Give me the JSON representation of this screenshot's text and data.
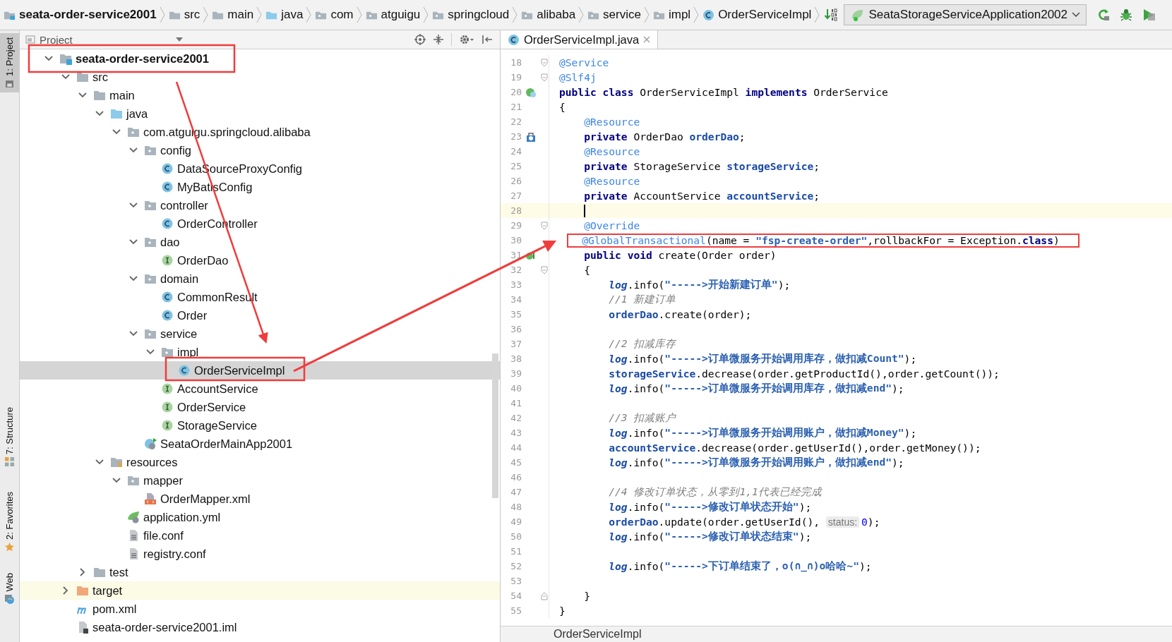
{
  "breadcrumbs": [
    {
      "label": "seata-order-service2001",
      "kind": "module"
    },
    {
      "label": "src",
      "kind": "folder"
    },
    {
      "label": "main",
      "kind": "folder"
    },
    {
      "label": "java",
      "kind": "source"
    },
    {
      "label": "com",
      "kind": "package"
    },
    {
      "label": "atguigu",
      "kind": "package"
    },
    {
      "label": "springcloud",
      "kind": "package"
    },
    {
      "label": "alibaba",
      "kind": "package"
    },
    {
      "label": "service",
      "kind": "package"
    },
    {
      "label": "impl",
      "kind": "package"
    },
    {
      "label": "OrderServiceImpl",
      "kind": "class"
    }
  ],
  "run_config": {
    "label": "SeataStorageServiceApplication2002"
  },
  "tool_windows": [
    {
      "label": "1: Project",
      "selected": true,
      "kind": "project"
    },
    {
      "label": "7: Structure",
      "selected": false,
      "kind": "structure"
    },
    {
      "label": "2: Favorites",
      "selected": false,
      "kind": "favorites"
    },
    {
      "label": "Web",
      "selected": false,
      "kind": "web"
    }
  ],
  "project": {
    "title": "Project",
    "tree": [
      {
        "label": "seata-order-service2001",
        "kind": "module",
        "expanded": true,
        "selected": false,
        "children": [
          {
            "label": "src",
            "kind": "folder",
            "expanded": true,
            "selected": false,
            "children": [
              {
                "label": "main",
                "kind": "folder",
                "expanded": true,
                "selected": false,
                "children": [
                  {
                    "label": "java",
                    "kind": "source",
                    "expanded": true,
                    "selected": false,
                    "children": [
                      {
                        "label": "com.atguigu.springcloud.alibaba",
                        "kind": "package",
                        "expanded": true,
                        "selected": false,
                        "children": [
                          {
                            "label": "config",
                            "kind": "package",
                            "expanded": true,
                            "selected": false,
                            "children": [
                              {
                                "label": "DataSourceProxyConfig",
                                "kind": "class",
                                "selected": false
                              },
                              {
                                "label": "MyBatisConfig",
                                "kind": "class",
                                "selected": false
                              }
                            ]
                          },
                          {
                            "label": "controller",
                            "kind": "package",
                            "expanded": true,
                            "selected": false,
                            "children": [
                              {
                                "label": "OrderController",
                                "kind": "class",
                                "selected": false
                              }
                            ]
                          },
                          {
                            "label": "dao",
                            "kind": "package",
                            "expanded": true,
                            "selected": false,
                            "children": [
                              {
                                "label": "OrderDao",
                                "kind": "interface",
                                "selected": false
                              }
                            ]
                          },
                          {
                            "label": "domain",
                            "kind": "package",
                            "expanded": true,
                            "selected": false,
                            "children": [
                              {
                                "label": "CommonResult",
                                "kind": "class",
                                "selected": false
                              },
                              {
                                "label": "Order",
                                "kind": "class",
                                "selected": false
                              }
                            ]
                          },
                          {
                            "label": "service",
                            "kind": "package",
                            "expanded": true,
                            "selected": false,
                            "children": [
                              {
                                "label": "impl",
                                "kind": "package",
                                "expanded": true,
                                "selected": false,
                                "children": [
                                  {
                                    "label": "OrderServiceImpl",
                                    "kind": "class",
                                    "selected": true
                                  }
                                ]
                              },
                              {
                                "label": "AccountService",
                                "kind": "interface",
                                "selected": false
                              },
                              {
                                "label": "OrderService",
                                "kind": "interface",
                                "selected": false
                              },
                              {
                                "label": "StorageService",
                                "kind": "interface",
                                "selected": false
                              }
                            ]
                          },
                          {
                            "label": "SeataOrderMainApp2001",
                            "kind": "boot",
                            "selected": false
                          }
                        ]
                      }
                    ]
                  },
                  {
                    "label": "resources",
                    "kind": "resources",
                    "expanded": true,
                    "selected": false,
                    "children": [
                      {
                        "label": "mapper",
                        "kind": "package",
                        "expanded": true,
                        "selected": false,
                        "children": [
                          {
                            "label": "OrderMapper.xml",
                            "kind": "xml",
                            "selected": false
                          }
                        ]
                      },
                      {
                        "label": "application.yml",
                        "kind": "yml",
                        "selected": false
                      },
                      {
                        "label": "file.conf",
                        "kind": "file",
                        "selected": false
                      },
                      {
                        "label": "registry.conf",
                        "kind": "file",
                        "selected": false
                      }
                    ]
                  }
                ]
              },
              {
                "label": "test",
                "kind": "folder",
                "expanded": false,
                "selected": false
              }
            ]
          },
          {
            "label": "target",
            "kind": "excluded",
            "expanded": false,
            "selected": false
          },
          {
            "label": "pom.xml",
            "kind": "maven",
            "selected": false
          },
          {
            "label": "seata-order-service2001.iml",
            "kind": "iml",
            "selected": false
          }
        ]
      }
    ]
  },
  "editor": {
    "tab": {
      "label": "OrderServiceImpl.java",
      "selected": true
    },
    "lines": [
      {
        "number": "18",
        "kind": "fold-start",
        "tokens": [
          {
            "kind": "ann",
            "text": "@Service"
          }
        ]
      },
      {
        "number": "19",
        "kind": "fold-start",
        "tokens": [
          {
            "kind": "ann",
            "text": "@Slf4j"
          }
        ]
      },
      {
        "number": "20",
        "kind": "bean",
        "tokens": [
          {
            "kind": "kw",
            "text": "public class "
          },
          {
            "kind": "plain",
            "text": "OrderServiceImpl "
          },
          {
            "kind": "kw",
            "text": "implements "
          },
          {
            "kind": "plain",
            "text": "OrderService"
          }
        ]
      },
      {
        "number": "21",
        "kind": "code",
        "tokens": [
          {
            "kind": "plain",
            "text": "{"
          }
        ],
        "children": [
          {
            "number": "22",
            "kind": "code",
            "tokens": [
              {
                "kind": "ann",
                "text": "@Resource"
              }
            ]
          },
          {
            "number": "23",
            "kind": "inject",
            "tokens": [
              {
                "kind": "kw",
                "text": "private "
              },
              {
                "kind": "plain",
                "text": "OrderDao "
              },
              {
                "kind": "field",
                "text": "orderDao"
              },
              {
                "kind": "plain",
                "text": ";"
              }
            ]
          },
          {
            "number": "24",
            "kind": "code",
            "tokens": [
              {
                "kind": "ann",
                "text": "@Resource"
              }
            ]
          },
          {
            "number": "25",
            "kind": "code",
            "tokens": [
              {
                "kind": "kw",
                "text": "private "
              },
              {
                "kind": "plain",
                "text": "StorageService "
              },
              {
                "kind": "field",
                "text": "storageService"
              },
              {
                "kind": "plain",
                "text": ";"
              }
            ]
          },
          {
            "number": "26",
            "kind": "code",
            "tokens": [
              {
                "kind": "ann",
                "text": "@Resource"
              }
            ]
          },
          {
            "number": "27",
            "kind": "code",
            "tokens": [
              {
                "kind": "kw",
                "text": "private "
              },
              {
                "kind": "plain",
                "text": "AccountService "
              },
              {
                "kind": "field",
                "text": "accountService"
              },
              {
                "kind": "plain",
                "text": ";"
              }
            ]
          },
          {
            "number": "28",
            "kind": "code",
            "current": true
          },
          {
            "number": "29",
            "kind": "fold-start",
            "tokens": [
              {
                "kind": "ann",
                "text": "@Override"
              }
            ]
          },
          {
            "number": "30",
            "kind": "code",
            "highlighted": true,
            "tokens": [
              {
                "kind": "ann",
                "text": "@GlobalTransactional"
              },
              {
                "kind": "plain",
                "text": "(name = "
              },
              {
                "kind": "str",
                "text": "\"fsp-create-order\""
              },
              {
                "kind": "plain",
                "text": ",rollbackFor = Exception."
              },
              {
                "kind": "kw",
                "text": "class"
              },
              {
                "kind": "plain",
                "text": ")"
              }
            ]
          },
          {
            "number": "31",
            "kind": "implements",
            "tokens": [
              {
                "kind": "kw",
                "text": "public void "
              },
              {
                "kind": "plain",
                "text": "create(Order order)"
              }
            ]
          },
          {
            "number": "32",
            "kind": "fold-start",
            "tokens": [
              {
                "kind": "plain",
                "text": "{"
              }
            ],
            "children": [
              {
                "number": "33",
                "kind": "code",
                "tokens": [
                  {
                    "kind": "static",
                    "text": "log"
                  },
                  {
                    "kind": "plain",
                    "text": ".info("
                  },
                  {
                    "kind": "str",
                    "text": "\"----->开始新建订单\""
                  },
                  {
                    "kind": "plain",
                    "text": ");"
                  }
                ]
              },
              {
                "number": "34",
                "kind": "code",
                "tokens": [
                  {
                    "kind": "cmt",
                    "text": "//1 新建订单"
                  }
                ]
              },
              {
                "number": "35",
                "kind": "code",
                "tokens": [
                  {
                    "kind": "field",
                    "text": "orderDao"
                  },
                  {
                    "kind": "plain",
                    "text": ".create(order);"
                  }
                ]
              },
              {
                "number": "36",
                "kind": "code"
              },
              {
                "number": "37",
                "kind": "code",
                "tokens": [
                  {
                    "kind": "cmt",
                    "text": "//2 扣减库存"
                  }
                ]
              },
              {
                "number": "38",
                "kind": "code",
                "tokens": [
                  {
                    "kind": "static",
                    "text": "log"
                  },
                  {
                    "kind": "plain",
                    "text": ".info("
                  },
                  {
                    "kind": "str",
                    "text": "\"----->订单微服务开始调用库存，做扣减Count\""
                  },
                  {
                    "kind": "plain",
                    "text": ");"
                  }
                ]
              },
              {
                "number": "39",
                "kind": "code",
                "tokens": [
                  {
                    "kind": "field",
                    "text": "storageService"
                  },
                  {
                    "kind": "plain",
                    "text": ".decrease(order.getProductId(),order.getCount());"
                  }
                ]
              },
              {
                "number": "40",
                "kind": "code",
                "tokens": [
                  {
                    "kind": "static",
                    "text": "log"
                  },
                  {
                    "kind": "plain",
                    "text": ".info("
                  },
                  {
                    "kind": "str",
                    "text": "\"----->订单微服务开始调用库存，做扣减end\""
                  },
                  {
                    "kind": "plain",
                    "text": ");"
                  }
                ]
              },
              {
                "number": "41",
                "kind": "code"
              },
              {
                "number": "42",
                "kind": "code",
                "tokens": [
                  {
                    "kind": "cmt",
                    "text": "//3 扣减账户"
                  }
                ]
              },
              {
                "number": "43",
                "kind": "code",
                "tokens": [
                  {
                    "kind": "static",
                    "text": "log"
                  },
                  {
                    "kind": "plain",
                    "text": ".info("
                  },
                  {
                    "kind": "str",
                    "text": "\"----->订单微服务开始调用账户，做扣减Money\""
                  },
                  {
                    "kind": "plain",
                    "text": ");"
                  }
                ]
              },
              {
                "number": "44",
                "kind": "code",
                "tokens": [
                  {
                    "kind": "field",
                    "text": "accountService"
                  },
                  {
                    "kind": "plain",
                    "text": ".decrease(order.getUserId(),order.getMoney());"
                  }
                ]
              },
              {
                "number": "45",
                "kind": "code",
                "tokens": [
                  {
                    "kind": "static",
                    "text": "log"
                  },
                  {
                    "kind": "plain",
                    "text": ".info("
                  },
                  {
                    "kind": "str",
                    "text": "\"----->订单微服务开始调用账户，做扣减end\""
                  },
                  {
                    "kind": "plain",
                    "text": ");"
                  }
                ]
              },
              {
                "number": "46",
                "kind": "code"
              },
              {
                "number": "47",
                "kind": "code",
                "tokens": [
                  {
                    "kind": "cmt",
                    "text": "//4 修改订单状态，从零到1,1代表已经完成"
                  }
                ]
              },
              {
                "number": "48",
                "kind": "code",
                "tokens": [
                  {
                    "kind": "static",
                    "text": "log"
                  },
                  {
                    "kind": "plain",
                    "text": ".info("
                  },
                  {
                    "kind": "str",
                    "text": "\"----->修改订单状态开始\""
                  },
                  {
                    "kind": "plain",
                    "text": ");"
                  }
                ]
              },
              {
                "number": "49",
                "kind": "code",
                "tokens": [
                  {
                    "kind": "field",
                    "text": "orderDao"
                  },
                  {
                    "kind": "plain",
                    "text": ".update(order.getUserId(), "
                  },
                  {
                    "kind": "hint",
                    "text": "status:"
                  },
                  {
                    "kind": "num",
                    "text": "0"
                  },
                  {
                    "kind": "plain",
                    "text": ");"
                  }
                ]
              },
              {
                "number": "50",
                "kind": "code",
                "tokens": [
                  {
                    "kind": "static",
                    "text": "log"
                  },
                  {
                    "kind": "plain",
                    "text": ".info("
                  },
                  {
                    "kind": "str",
                    "text": "\"----->修改订单状态结束\""
                  },
                  {
                    "kind": "plain",
                    "text": ");"
                  }
                ]
              },
              {
                "number": "51",
                "kind": "code"
              },
              {
                "number": "52",
                "kind": "code",
                "tokens": [
                  {
                    "kind": "static",
                    "text": "log"
                  },
                  {
                    "kind": "plain",
                    "text": ".info("
                  },
                  {
                    "kind": "str",
                    "text": "\"----->下订单结束了，o(∩_∩)o哈哈~\""
                  },
                  {
                    "kind": "plain",
                    "text": ");"
                  }
                ]
              },
              {
                "number": "53",
                "kind": "code"
              }
            ]
          },
          {
            "number": "54",
            "kind": "fold-end",
            "tokens": [
              {
                "kind": "plain",
                "text": "}"
              }
            ]
          }
        ]
      },
      {
        "number": "55",
        "kind": "code",
        "tokens": [
          {
            "kind": "plain",
            "text": "}"
          }
        ]
      }
    ],
    "footer": "OrderServiceImpl"
  }
}
